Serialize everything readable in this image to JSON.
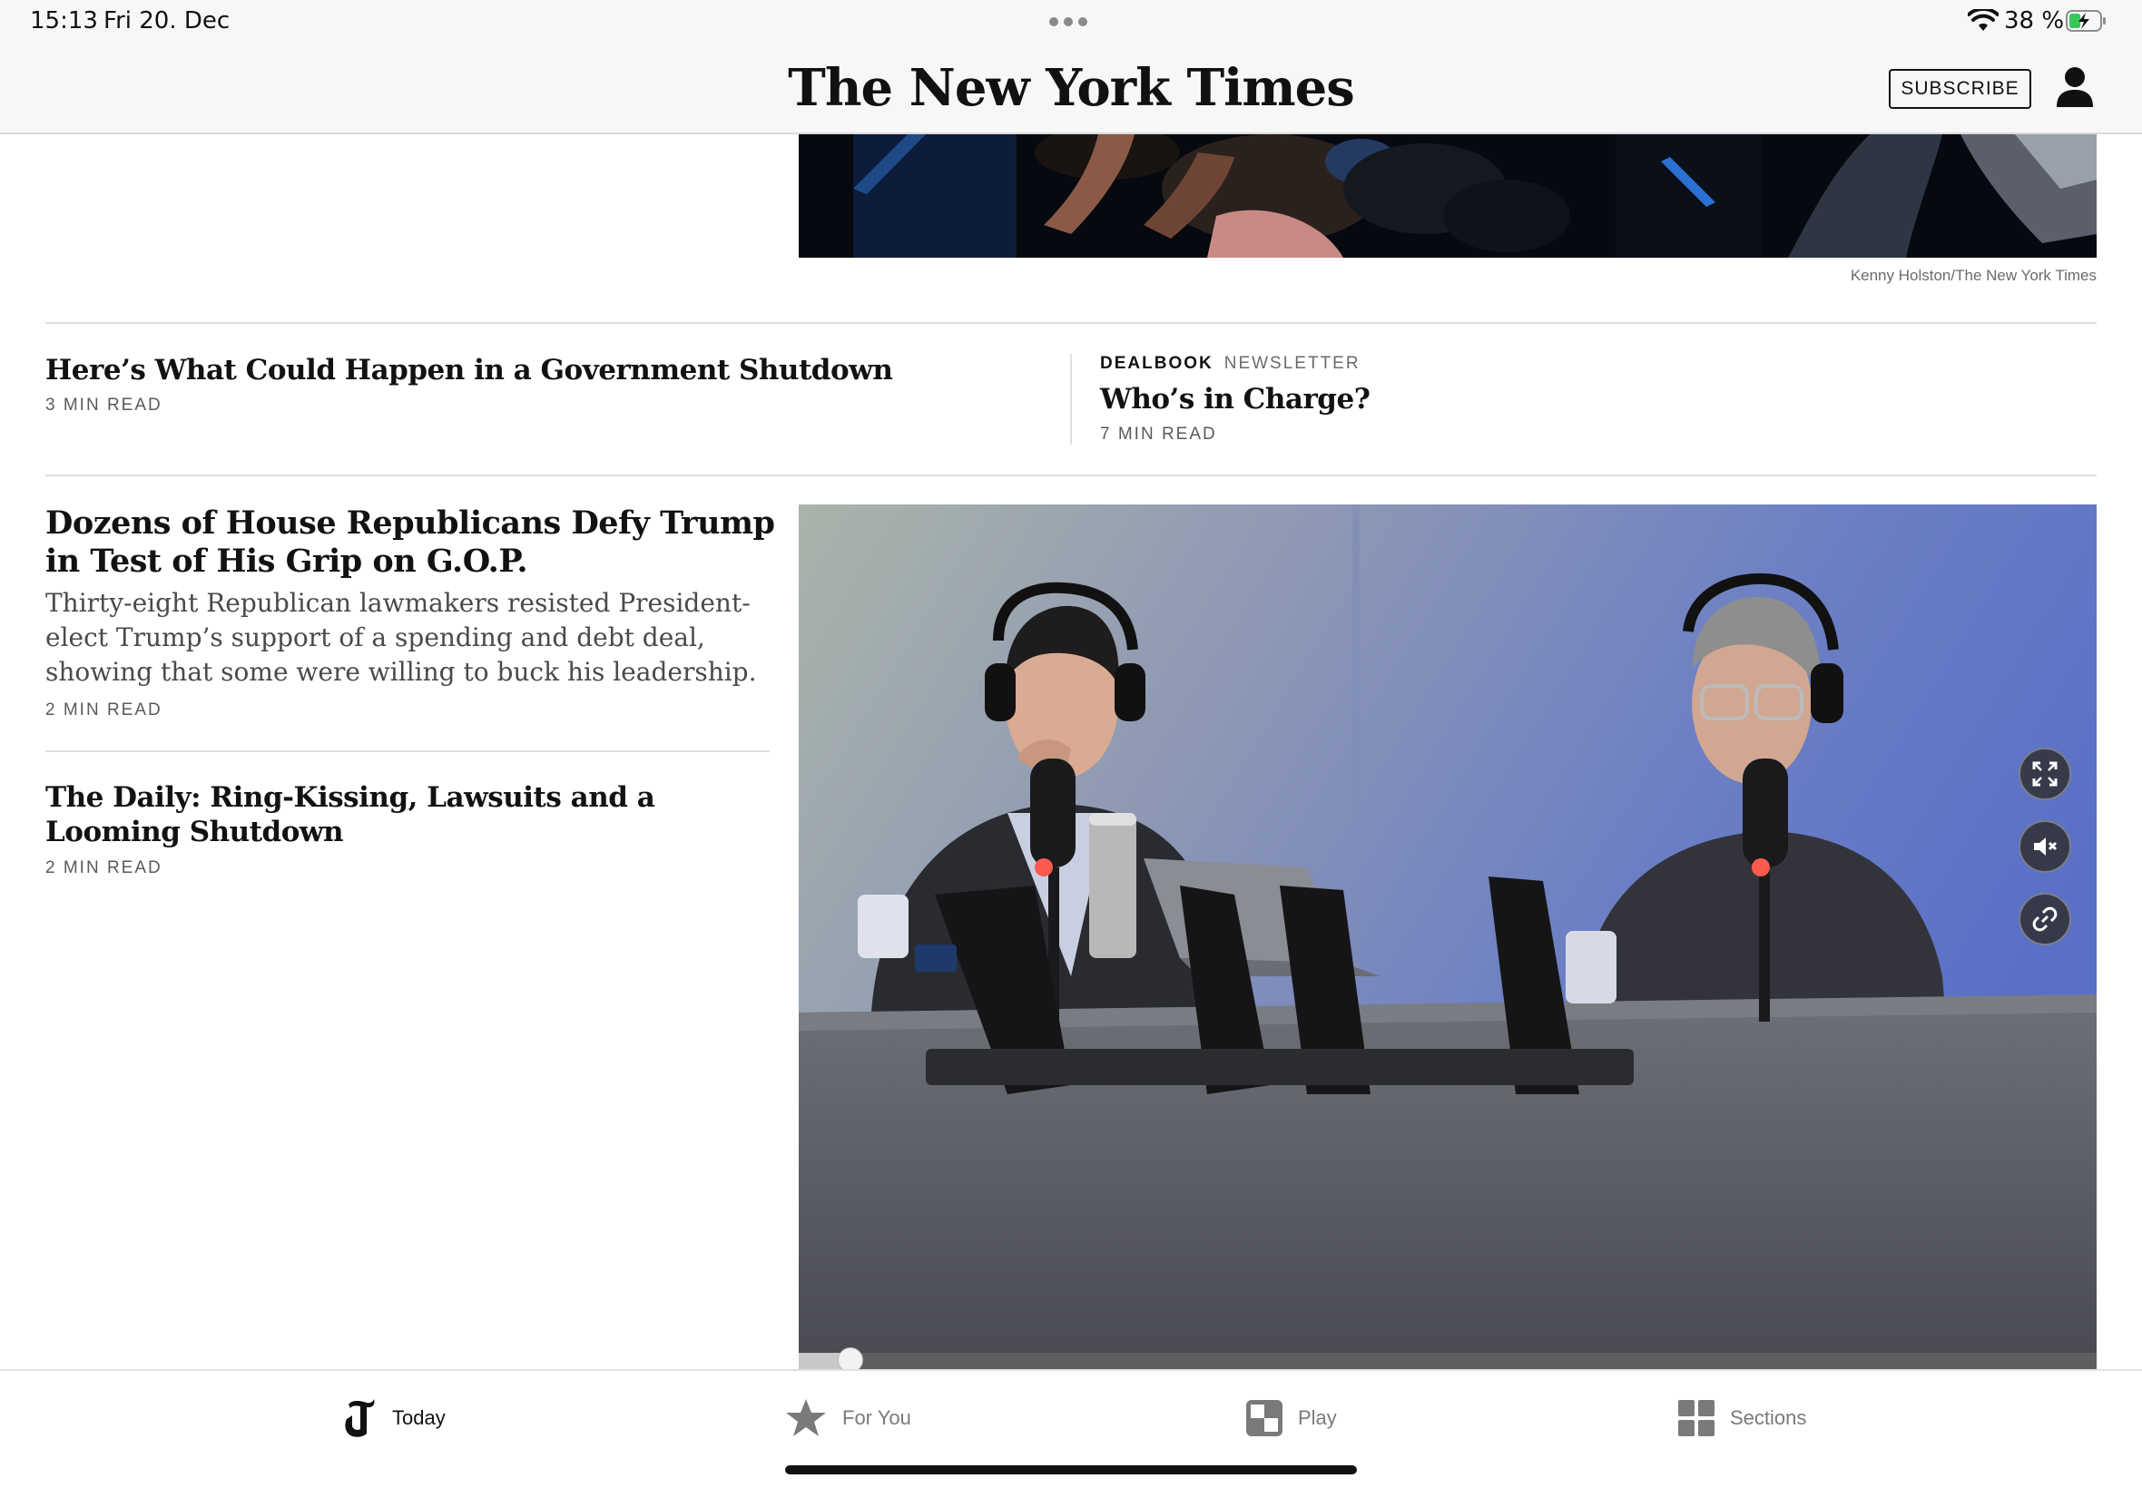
{
  "status_bar": {
    "time": "15:13",
    "date": "Fri 20. Dec",
    "battery_percent": "38 %",
    "battery_level": 0.38,
    "charging": true
  },
  "masthead": {
    "logo_text": "The New York Times",
    "subscribe_label": "SUBSCRIBE",
    "account_icon": "account-icon"
  },
  "top_story": {
    "photo_credit": "Kenny Holston/The New York Times"
  },
  "stories_row": [
    {
      "headline": "Here’s What Could Happen in a Government Shutdown",
      "read_time": "3 MIN READ"
    },
    {
      "kicker_primary": "DEALBOOK",
      "kicker_secondary": "NEWSLETTER",
      "headline": "Who’s in Charge?",
      "read_time": "7 MIN READ"
    }
  ],
  "lead_story": {
    "headline": "Dozens of House Republicans Defy Trump in Test of His Grip on G.O.P.",
    "summary": "Thirty-eight Republican lawmakers resisted President-elect Trump’s support of a spending and debt deal, showing that some were willing to buck his leadership.",
    "read_time": "2 MIN READ"
  },
  "daily_story": {
    "headline": "The Daily: Ring-Kissing, Lawsuits and a Looming Shutdown",
    "read_time": "2 MIN READ"
  },
  "video": {
    "progress": 0.04,
    "controls": [
      "expand-icon",
      "mute-icon",
      "link-icon"
    ]
  },
  "tab_bar": {
    "active": "Today",
    "tabs": [
      {
        "label": "Today",
        "icon": "nyt-t-icon"
      },
      {
        "label": "For You",
        "icon": "star-icon"
      },
      {
        "label": "Play",
        "icon": "play-games-icon"
      },
      {
        "label": "Sections",
        "icon": "sections-grid-icon"
      }
    ]
  },
  "colors": {
    "text": "#121212",
    "secondary_text": "#5a5a5a",
    "divider": "#dfdfdf",
    "chrome_background": "#f7f7f7",
    "battery_green": "#34c759"
  }
}
